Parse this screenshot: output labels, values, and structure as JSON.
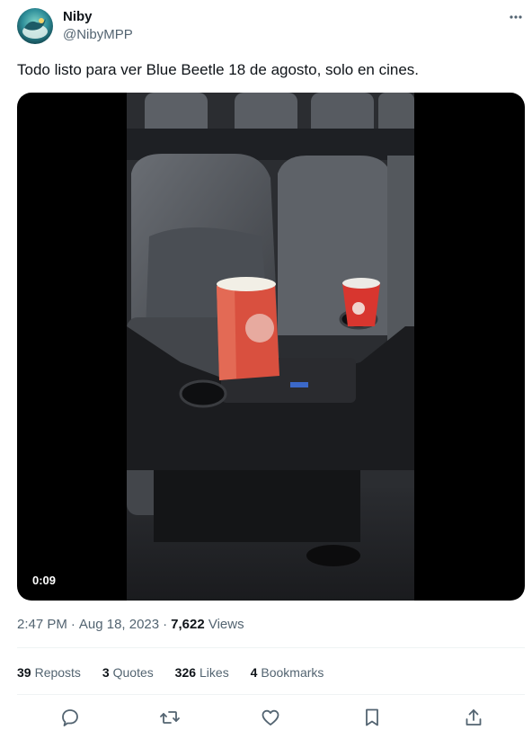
{
  "tweet": {
    "author": {
      "display_name": "Niby",
      "handle": "@NibyMPP",
      "avatar_icon": "avatar-image"
    },
    "text": "Todo listo para ver Blue Beetle 18 de agosto, solo en cines.",
    "media": {
      "type": "video",
      "duration": "0:09"
    },
    "meta": {
      "time": "2:47 PM",
      "date": "Aug 18, 2023",
      "separator": "·",
      "views_count": "7,622",
      "views_label": "Views"
    },
    "stats": {
      "reposts_count": "39",
      "reposts_label": "Reposts",
      "quotes_count": "3",
      "quotes_label": "Quotes",
      "likes_count": "326",
      "likes_label": "Likes",
      "bookmarks_count": "4",
      "bookmarks_label": "Bookmarks"
    },
    "actions": {
      "reply_icon": "reply-icon",
      "repost_icon": "repost-icon",
      "like_icon": "heart-icon",
      "bookmark_icon": "bookmark-icon",
      "share_icon": "share-icon"
    }
  },
  "colors": {
    "text_primary": "#0f1419",
    "text_secondary": "#536471",
    "divider": "#eff3f4",
    "media_background": "#000000"
  }
}
